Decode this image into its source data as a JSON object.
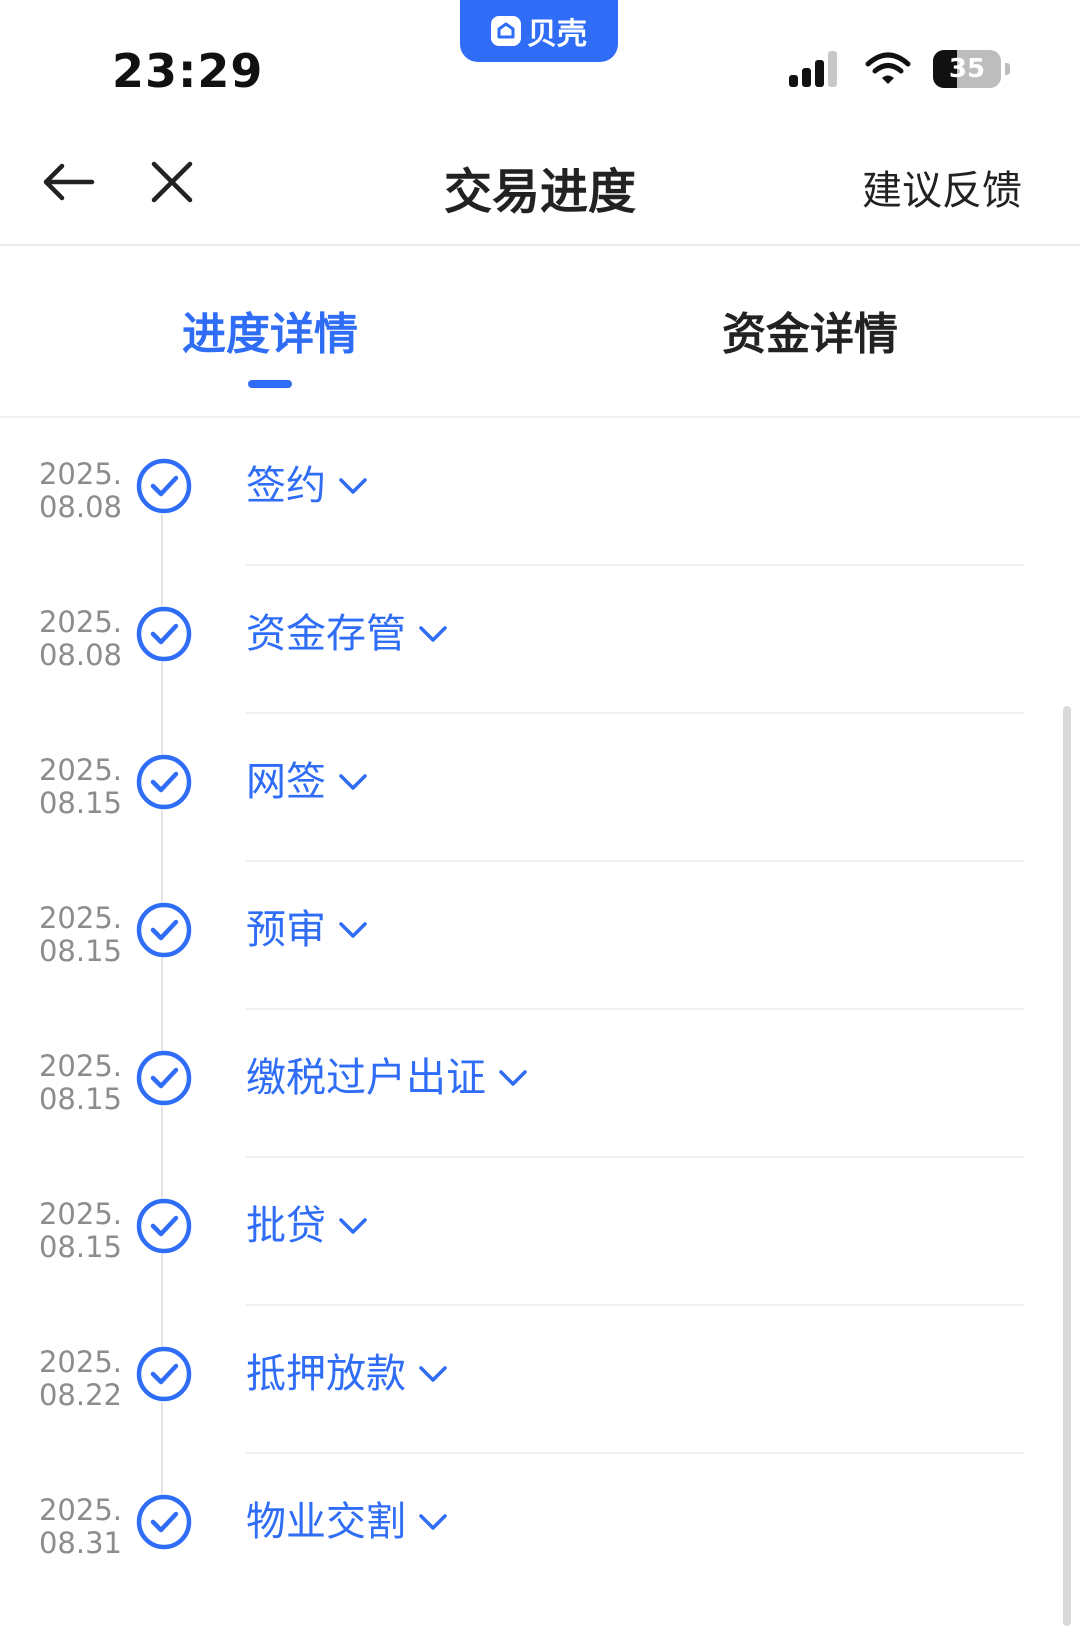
{
  "status_bar": {
    "time": "23:29",
    "app_label": "贝壳",
    "battery": "35",
    "icons": [
      "cellular-signal-icon",
      "wifi-icon",
      "battery-icon"
    ]
  },
  "nav": {
    "title": "交易进度",
    "feedback": "建议反馈",
    "back_icon": "arrow-left-icon",
    "close_icon": "close-icon"
  },
  "tabs": [
    {
      "label": "进度详情",
      "active": true
    },
    {
      "label": "资金详情",
      "active": false
    }
  ],
  "steps": [
    {
      "year": "2025.",
      "date": "08.08",
      "title": "签约"
    },
    {
      "year": "2025.",
      "date": "08.08",
      "title": "资金存管"
    },
    {
      "year": "2025.",
      "date": "08.15",
      "title": "网签"
    },
    {
      "year": "2025.",
      "date": "08.15",
      "title": "预审"
    },
    {
      "year": "2025.",
      "date": "08.15",
      "title": "缴税过户出证"
    },
    {
      "year": "2025.",
      "date": "08.15",
      "title": "批贷"
    },
    {
      "year": "2025.",
      "date": "08.22",
      "title": "抵押放款"
    },
    {
      "year": "2025.",
      "date": "08.31",
      "title": "物业交割"
    }
  ],
  "colors": {
    "accent": "#2f6df6",
    "date_gray": "#8c8c8c",
    "divider": "#f0f0f0"
  }
}
